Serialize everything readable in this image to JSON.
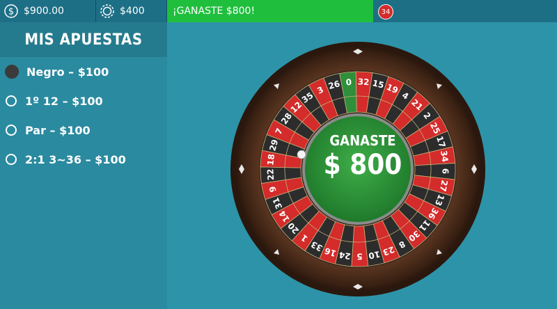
{
  "header": {
    "balance": "$900.00",
    "balance_icon": "dollar-coin-icon",
    "bet_total": "$400",
    "bet_icon": "poker-chip-icon",
    "win_message": "¡GANASTE $800!",
    "last_number": "34",
    "colors": {
      "bar": "#1d6f86",
      "win": "#1fbf3d",
      "red": "#d42b2b"
    }
  },
  "bets_panel": {
    "title": "MIS APUESTAS",
    "items": [
      {
        "label": "Negro – $100",
        "selected": true
      },
      {
        "label": "1º 12 – $100",
        "selected": false
      },
      {
        "label": "Par – $100",
        "selected": false
      },
      {
        "label": "2:1 3~36 – $100",
        "selected": false
      }
    ]
  },
  "wheel": {
    "center_label": "GANASTE",
    "center_amount": "$ 800",
    "numbers": [
      "0",
      "32",
      "15",
      "19",
      "4",
      "21",
      "2",
      "25",
      "17",
      "34",
      "6",
      "27",
      "13",
      "36",
      "11",
      "30",
      "8",
      "23",
      "10",
      "5",
      "24",
      "16",
      "33",
      "1",
      "20",
      "14",
      "31",
      "9",
      "22",
      "18",
      "29",
      "7",
      "28",
      "12",
      "35",
      "3",
      "26"
    ],
    "red_numbers": [
      "32",
      "19",
      "21",
      "25",
      "34",
      "27",
      "36",
      "30",
      "23",
      "5",
      "16",
      "1",
      "14",
      "9",
      "18",
      "7",
      "12",
      "3"
    ],
    "colors": {
      "red": "#d42b2b",
      "black": "#2c2c2c",
      "green": "#2f8f3a",
      "wood": "#4a2a1a"
    }
  }
}
